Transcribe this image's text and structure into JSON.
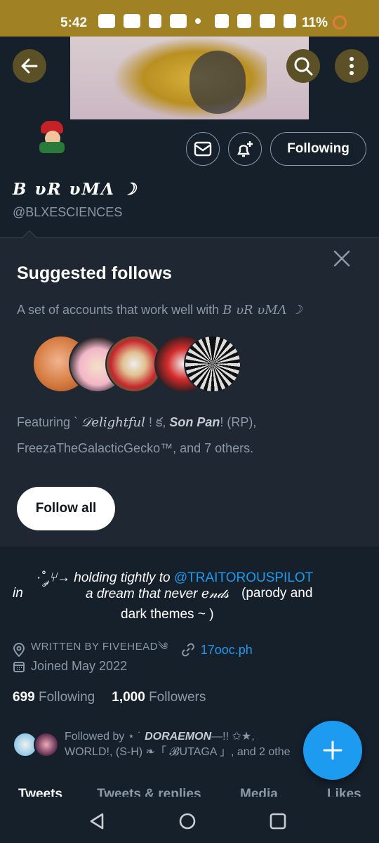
{
  "status_bar": {
    "time": "5:42",
    "battery": "11%"
  },
  "profile": {
    "display_name": "B υR υMΛ ☽",
    "handle": "@BLXESCIENCES",
    "following_button": "Following"
  },
  "suggested": {
    "title": "Suggested follows",
    "desc_prefix": "A set of accounts that work well with ",
    "desc_name": "B υR υMΛ ☽",
    "featuring_prefix": "Featuring  ` ",
    "featuring_name1": "𝒟elightful",
    "featuring_mid1": " !  క, ",
    "featuring_name2": "Son Pan",
    "featuring_mid2": "! (RP),",
    "featuring_line2": "FreezaTheGalacticGecko™, and 7 others.",
    "follow_all": "Follow all"
  },
  "bio": {
    "line1_prefix": "·˚ ༘⑂→ holding tightly to ",
    "line1_link": "@TRAITOROUSPILOT",
    "line2_in": "in",
    "line2_dream": "a dream that never ℯ𝓃𝒹𝓈",
    "line2_paren": "(parody and",
    "line3": "dark themes ~ )"
  },
  "meta": {
    "location": "WRITTEN BY FIVEHEAD༄",
    "link": "17ooc.ph",
    "joined": "Joined May 2022"
  },
  "counts": {
    "following_num": "699",
    "following_label": "Following",
    "followers_num": "1,000",
    "followers_label": "Followers"
  },
  "followed_by": {
    "prefix": "Followed by ⋆  ˙ ",
    "name1": "DORAEMON",
    "line1_end": "—!! ✩★,",
    "line2": "WORLD!, (S-H) ❧「 𝓑UTAGA 」, and 2 othe"
  },
  "tabs": [
    "Tweets",
    "Tweets & replies",
    "Media",
    "Likes"
  ],
  "colors": {
    "accent": "#1d9bf0",
    "background": "#15202b",
    "card": "#1e2732",
    "status_bar": "#a08225"
  }
}
